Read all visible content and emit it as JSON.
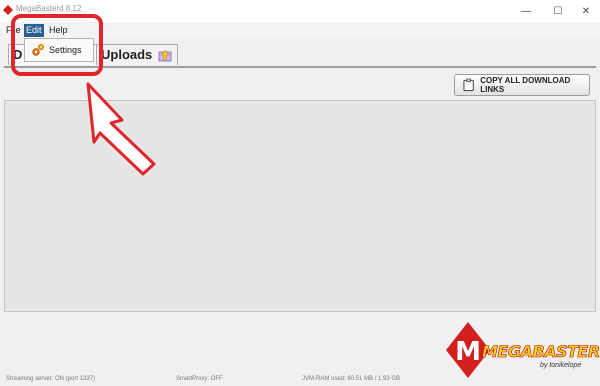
{
  "window": {
    "title": "MegaBasterd 8.12",
    "controls": {
      "minimize": "—",
      "maximize": "☐",
      "close": "✕"
    }
  },
  "menubar": {
    "file": "File",
    "edit": "Edit",
    "help": "Help"
  },
  "edit_menu": {
    "settings": "Settings"
  },
  "tabs": {
    "downloads": "D",
    "uploads": "Uploads"
  },
  "toolbar": {
    "copy_links": "COPY ALL DOWNLOAD LINKS"
  },
  "status": {
    "streaming": "Streaming server: ON (port 1337)",
    "proxy": "SmartProxy: OFF",
    "ram": "JVM-RAM used: 60.51 MB / 1.93 GB"
  },
  "logo": {
    "wordmark": "MEGABASTERD",
    "byline": "by tonikelope"
  },
  "colors": {
    "menu_highlight": "#2b5f94",
    "annotation": "#e0252b",
    "logo_red": "#d21f1f",
    "logo_yellow": "#ffd21f"
  }
}
